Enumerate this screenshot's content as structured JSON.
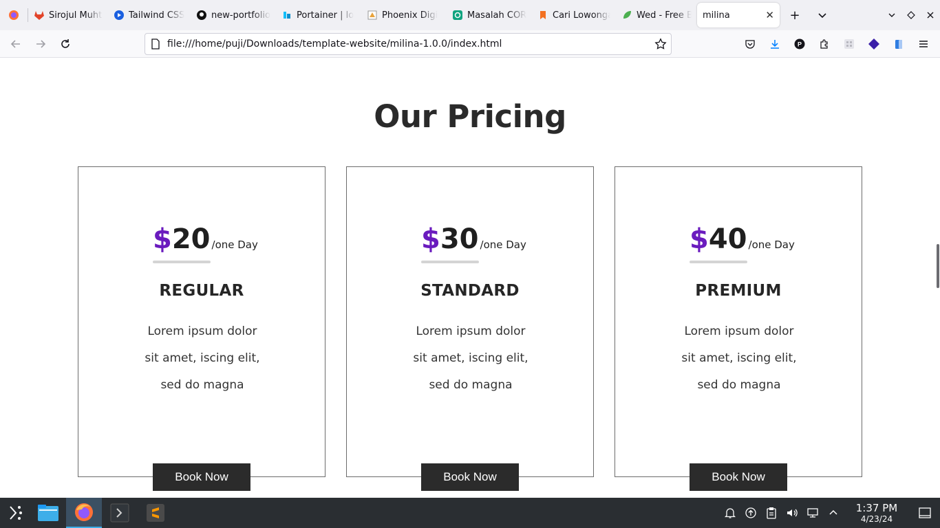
{
  "browser": {
    "tabs": [
      {
        "title": "Sirojul Muhta",
        "icon": "gitlab-icon",
        "color": "#e24329"
      },
      {
        "title": "Tailwind CSS",
        "icon": "play-icon",
        "color": "#1a5fe0"
      },
      {
        "title": "new-portfolio",
        "icon": "github-icon",
        "color": "#111111"
      },
      {
        "title": "Portainer | lo",
        "icon": "portainer-icon",
        "color": "#13bef9"
      },
      {
        "title": "Phoenix Digi",
        "icon": "phoenix-icon",
        "color": "#e8a33d"
      },
      {
        "title": "Masalah COR",
        "icon": "openai-icon",
        "color": "#10a37f"
      },
      {
        "title": "Cari Lowonga",
        "icon": "bookmark-icon",
        "color": "#f37021"
      },
      {
        "title": "Wed - Free B",
        "icon": "leaf-icon",
        "color": "#4caf50"
      },
      {
        "title": "milina",
        "icon": "",
        "color": ""
      }
    ],
    "active_tab_index": 8,
    "url": "file:///home/puji/Downloads/template-website/milina-1.0.0/index.html"
  },
  "page": {
    "section_title": "Our Pricing",
    "accent_color": "#6a1bbe",
    "plans": [
      {
        "currency": "$",
        "amount": "20",
        "period": "/one Day",
        "name": "REGULAR",
        "description": "Lorem ipsum dolor sit amet, iscing elit, sed do magna",
        "button": "Book Now"
      },
      {
        "currency": "$",
        "amount": "30",
        "period": "/one Day",
        "name": "STANDARD",
        "description": "Lorem ipsum dolor sit amet, iscing elit, sed do magna",
        "button": "Book Now"
      },
      {
        "currency": "$",
        "amount": "40",
        "period": "/one Day",
        "name": "PREMIUM",
        "description": "Lorem ipsum dolor sit amet, iscing elit, sed do magna",
        "button": "Book Now"
      }
    ]
  },
  "taskbar": {
    "apps": [
      "app-launcher-icon",
      "file-manager-icon",
      "firefox-icon",
      "terminal-icon",
      "sublime-text-icon"
    ],
    "time": "1:37 PM",
    "date": "4/23/24"
  }
}
